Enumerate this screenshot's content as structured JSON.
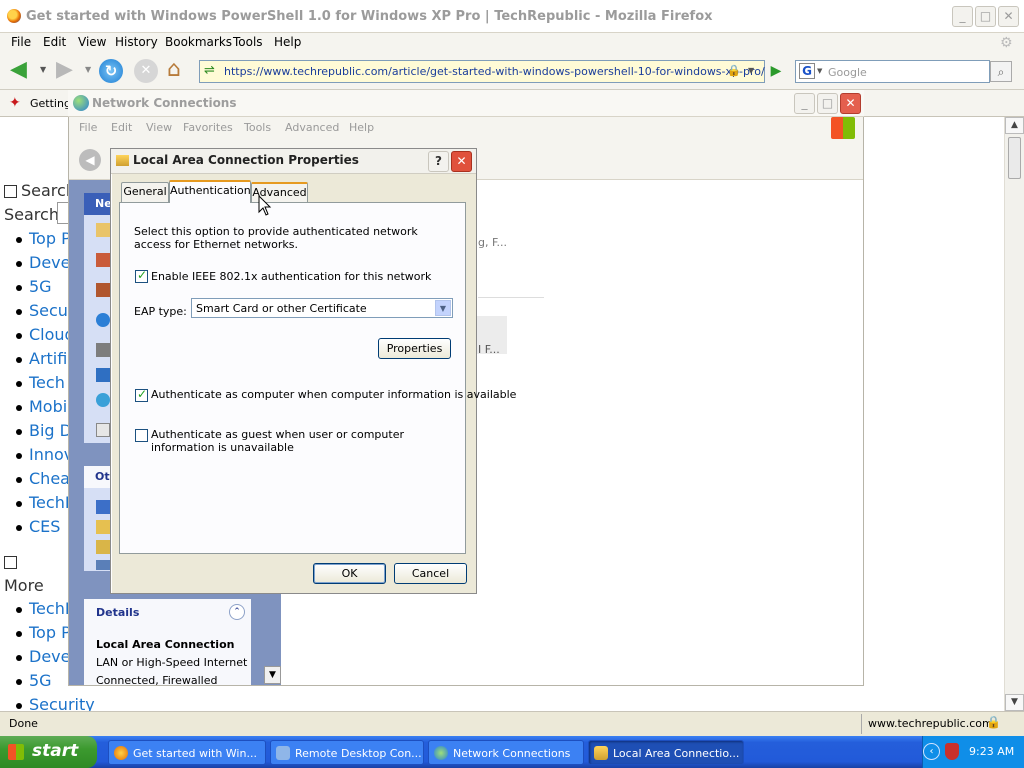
{
  "firefox": {
    "title": "Get started with Windows PowerShell 1.0 for Windows XP Pro | TechRepublic - Mozilla Firefox",
    "menu": [
      "File",
      "Edit",
      "View",
      "History",
      "Bookmarks",
      "Tools",
      "Help"
    ],
    "url": "https://www.techrepublic.com/article/get-started-with-windows-powershell-10-for-windows-xp-pro/",
    "search_placeholder": "Google",
    "bookmark_label": "Getting",
    "status_left": "Done",
    "status_right": "www.techrepublic.com"
  },
  "page": {
    "search_heading": "Search",
    "search_label": "Search",
    "links": [
      "Top P",
      "Deve",
      "5G",
      "Secu",
      "Cloud",
      "Artific",
      "Tech",
      "Mobil",
      "Big D",
      "Innov",
      "Chea",
      "TechR",
      "CES"
    ],
    "more_label": "More",
    "more_links": [
      "TechR",
      "Top P",
      "Deve",
      "5G",
      "Security"
    ]
  },
  "network_connections": {
    "title": "Network Connections",
    "menu": [
      "File",
      "Edit",
      "View",
      "Favorites",
      "Tools",
      "Advanced",
      "Help"
    ],
    "side_header": "Ne",
    "other_header": "Ot",
    "right_snippet_1": "g, F...",
    "right_snippet_2": "I F...",
    "details": {
      "header": "Details",
      "name": "Local Area Connection",
      "line1": "LAN or High-Speed Internet",
      "line2": "Connected, Firewalled"
    }
  },
  "dialog": {
    "title": "Local Area Connection Properties",
    "tabs": [
      "General",
      "Authentication",
      "Advanced"
    ],
    "active_tab": "Authentication",
    "description": "Select this option to provide authenticated network access for Ethernet networks.",
    "enable_8021x": {
      "label": "Enable IEEE 802.1x authentication for this network",
      "checked": true
    },
    "eap_label": "EAP type:",
    "eap_value": "Smart Card or other Certificate",
    "properties_button": "Properties",
    "auth_computer": {
      "label": "Authenticate as computer when computer information is available",
      "checked": true
    },
    "auth_guest": {
      "label": "Authenticate as guest when user or computer information is unavailable",
      "checked": false
    },
    "ok": "OK",
    "cancel": "Cancel"
  },
  "taskbar": {
    "start": "start",
    "items": [
      "Get started with Win...",
      "Remote Desktop Con...",
      "Network Connections",
      "Local Area Connectio..."
    ],
    "active_index": 3,
    "clock": "9:23 AM"
  },
  "colors": {
    "xp_blue": "#245edb",
    "start_green": "#3c9a2f",
    "tab_highlight": "#e69a20",
    "link_blue": "#1b72c9"
  }
}
